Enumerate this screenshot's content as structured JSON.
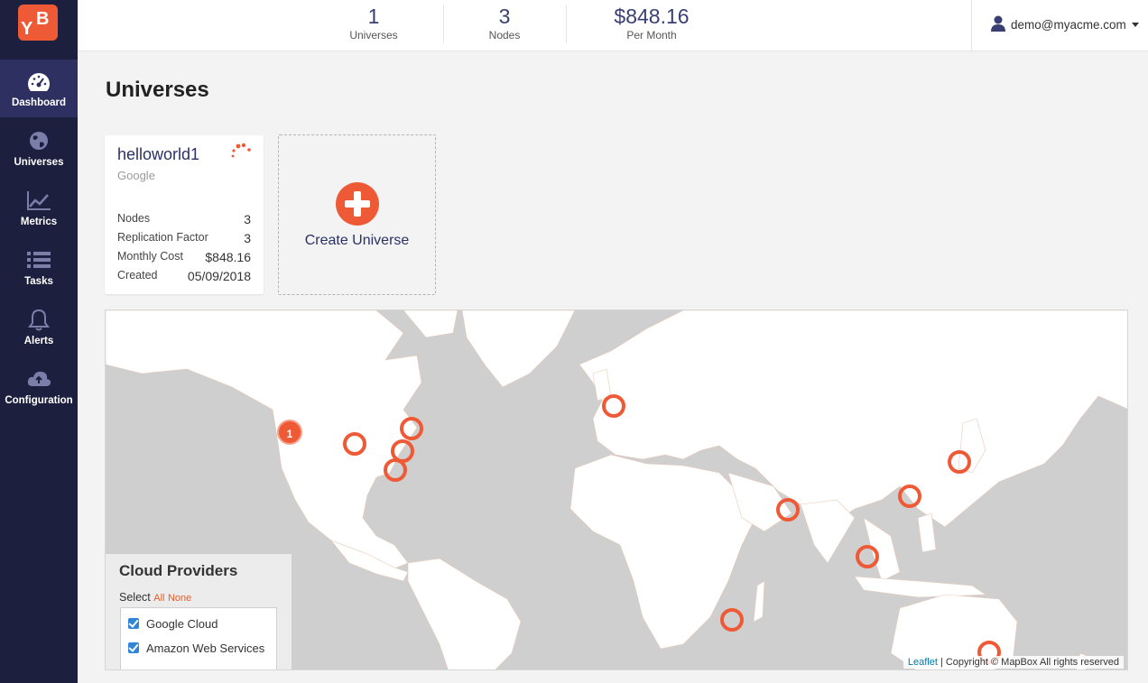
{
  "brand": {
    "logo_text": "YB",
    "accent": "#ef5a36",
    "sidebar_bg": "#1d1f3f",
    "active_bg": "#2d3061"
  },
  "sidebar": {
    "items": [
      {
        "label": "Dashboard",
        "icon": "dashboard-icon",
        "active": true
      },
      {
        "label": "Universes",
        "icon": "globe-icon",
        "active": false
      },
      {
        "label": "Metrics",
        "icon": "chart-line-icon",
        "active": false
      },
      {
        "label": "Tasks",
        "icon": "list-icon",
        "active": false
      },
      {
        "label": "Alerts",
        "icon": "bell-icon",
        "active": false
      },
      {
        "label": "Configuration",
        "icon": "cloud-upload-icon",
        "active": false
      }
    ]
  },
  "header": {
    "stats": [
      {
        "value": "1",
        "label": "Universes"
      },
      {
        "value": "3",
        "label": "Nodes"
      },
      {
        "value": "$848.16",
        "label": "Per Month"
      }
    ],
    "user": {
      "email": "demo@myacme.com",
      "icon": "user-icon"
    }
  },
  "page": {
    "title": "Universes"
  },
  "universe_card": {
    "name": "helloworld1",
    "provider": "Google",
    "rows": [
      {
        "label": "Nodes",
        "value": "3"
      },
      {
        "label": "Replication Factor",
        "value": "3"
      },
      {
        "label": "Monthly Cost",
        "value": "$848.16"
      },
      {
        "label": "Created",
        "value": "05/09/2018"
      }
    ]
  },
  "create_card": {
    "label": "Create Universe",
    "icon": "plus-circle-icon"
  },
  "map": {
    "cluster": {
      "count": "1"
    },
    "providers_panel": {
      "title": "Cloud Providers",
      "select_label": "Select",
      "all_label": "All",
      "none_label": "None",
      "items": [
        {
          "label": "Google Cloud",
          "checked": true
        },
        {
          "label": "Amazon Web Services",
          "checked": true
        }
      ]
    },
    "attribution": {
      "leaflet": "Leaflet",
      "text": " | Copyright © MapBox All rights reserved"
    }
  }
}
